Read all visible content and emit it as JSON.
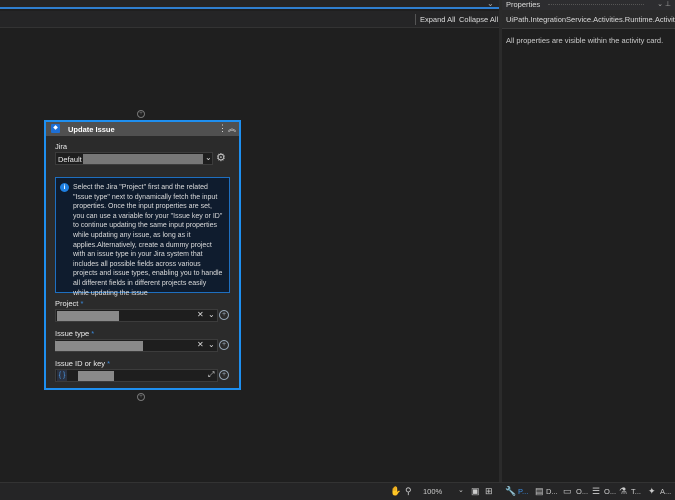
{
  "toolbar": {
    "expand_all": "Expand All",
    "collapse_all": "Collapse All"
  },
  "properties": {
    "title": "Properties",
    "type": "UiPath.IntegrationService.Activities.Runtime.Activitie...",
    "description": "All properties are visible within the activity card."
  },
  "card": {
    "title": "Update Issue",
    "connection": {
      "label": "Jira",
      "value": "Default"
    },
    "info": "Select the Jira \"Project\" first and the related \"Issue type\" next to dynamically fetch the input properties. Once the input properties are set, you can use a variable for your \"Issue key or ID\" to continue updating the same input properties while updating any issue, as long as it applies.Alternatively, create a dummy project with an issue type in your Jira system that includes all possible fields across various projects and issue types, enabling you to handle all different fields in different projects easily while updating the issue",
    "fields": [
      {
        "label": "Project",
        "required": "*"
      },
      {
        "label": "Issue type",
        "required": "*"
      },
      {
        "label": "Issue ID or key",
        "required": "*",
        "prefix": "{ }"
      }
    ]
  },
  "status": {
    "zoom": "100%",
    "tabs": [
      {
        "label": "P...",
        "icon": "wrench-icon"
      },
      {
        "label": "D...",
        "icon": "clipboard-icon"
      },
      {
        "label": "O...",
        "icon": "output-icon"
      },
      {
        "label": "O...",
        "icon": "outline-icon"
      },
      {
        "label": "T...",
        "icon": "test-icon"
      },
      {
        "label": "A...",
        "icon": "assistant-icon"
      }
    ]
  },
  "colors": {
    "accent": "#1e8ff0",
    "background": "#1f1f1f"
  }
}
